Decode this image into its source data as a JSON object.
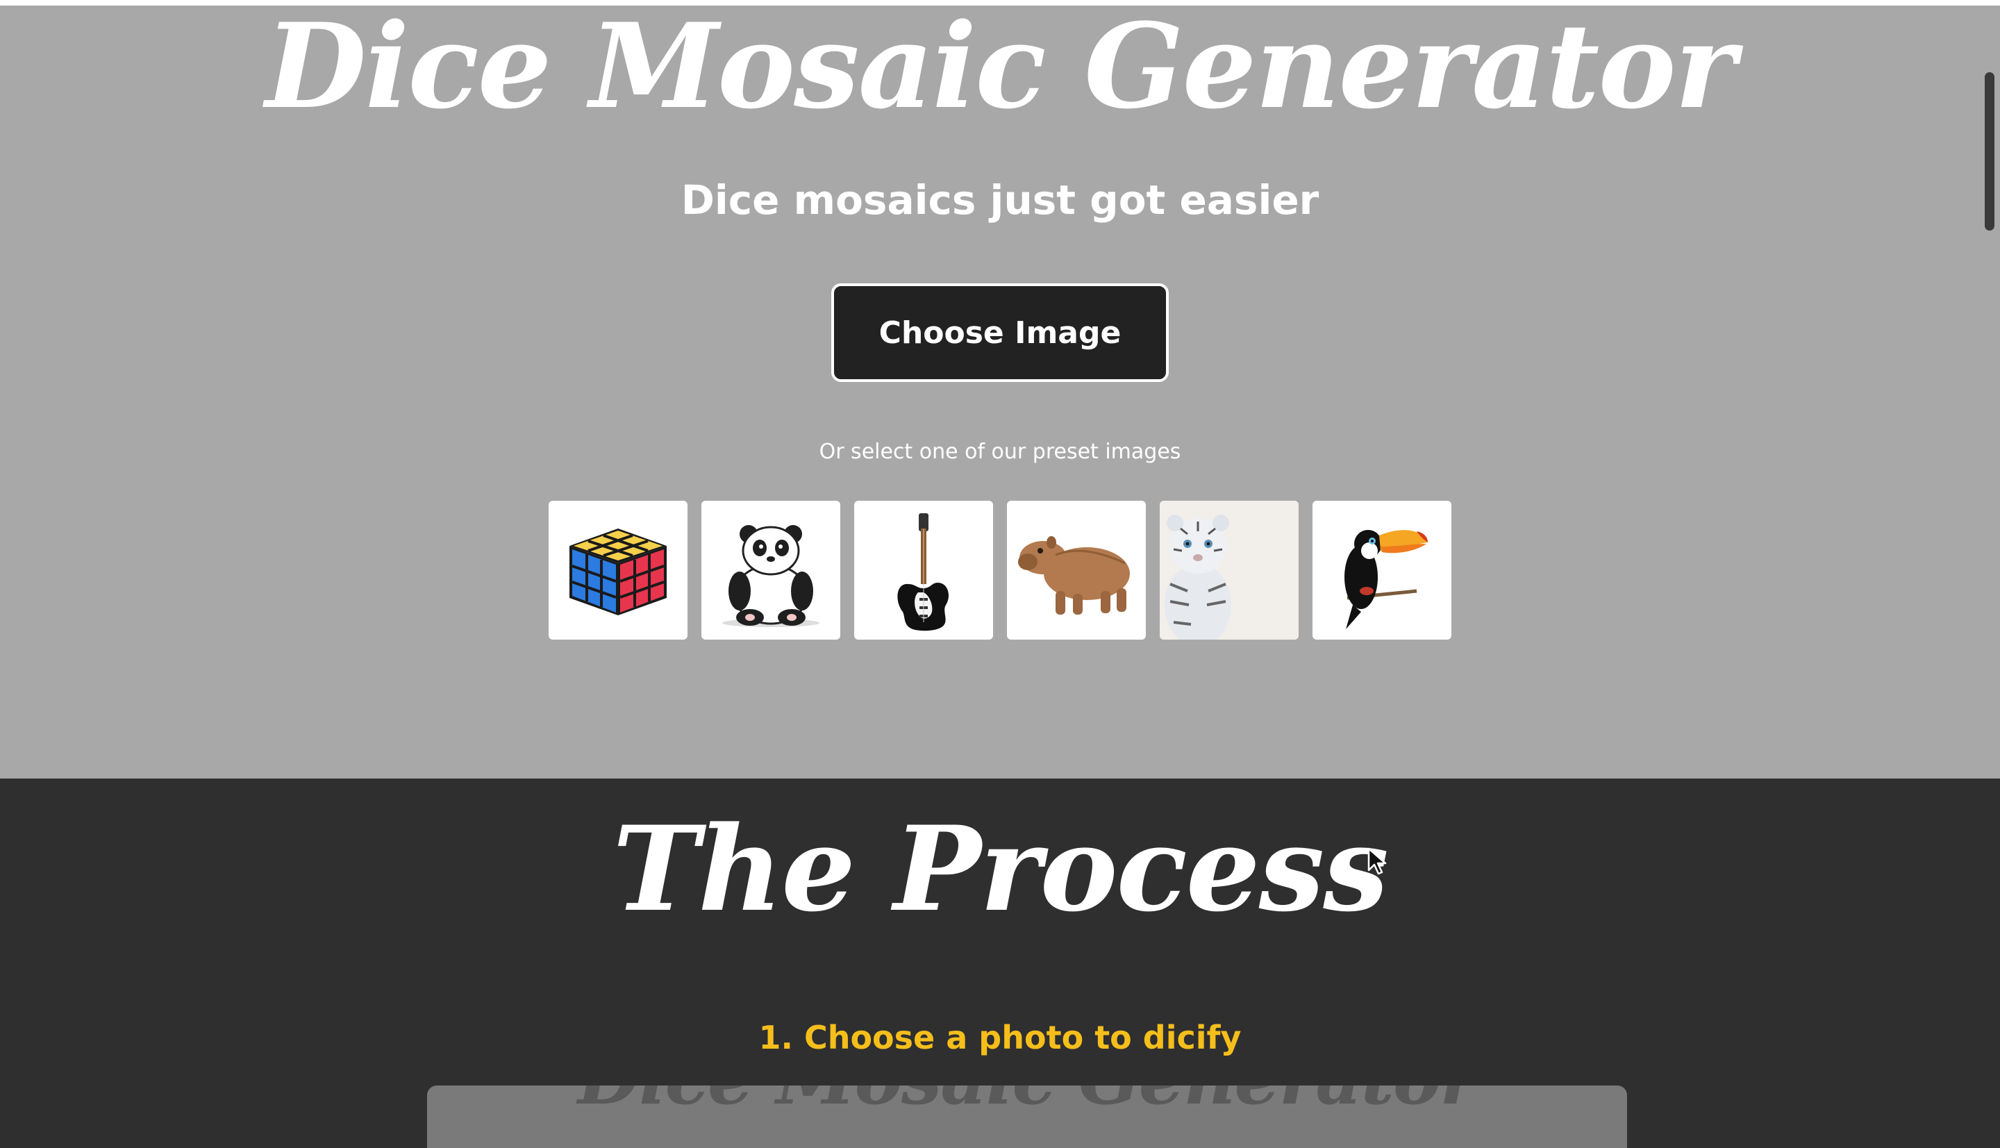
{
  "hero": {
    "title": "Dice Mosaic Generator",
    "tagline": "Dice mosaics just got easier",
    "choose_button_label": "Choose Image",
    "preset_hint": "Or select one of our preset images",
    "presets": [
      {
        "name": "rubiks-cube",
        "icon": "rubiks-cube-icon"
      },
      {
        "name": "panda",
        "icon": "panda-icon"
      },
      {
        "name": "electric-guitar",
        "icon": "guitar-icon"
      },
      {
        "name": "capybara",
        "icon": "capybara-icon"
      },
      {
        "name": "white-tiger",
        "icon": "tiger-icon"
      },
      {
        "name": "toucan",
        "icon": "toucan-icon"
      }
    ]
  },
  "process": {
    "title": "The Process",
    "step1_title": "1. Choose a photo to dicify",
    "preview_title": "Dice Mosaic Generator"
  },
  "colors": {
    "hero_bg": "#a8a8a8",
    "process_bg": "#2f2f2f",
    "button_bg": "#222222",
    "step_accent": "#f5be1b"
  }
}
